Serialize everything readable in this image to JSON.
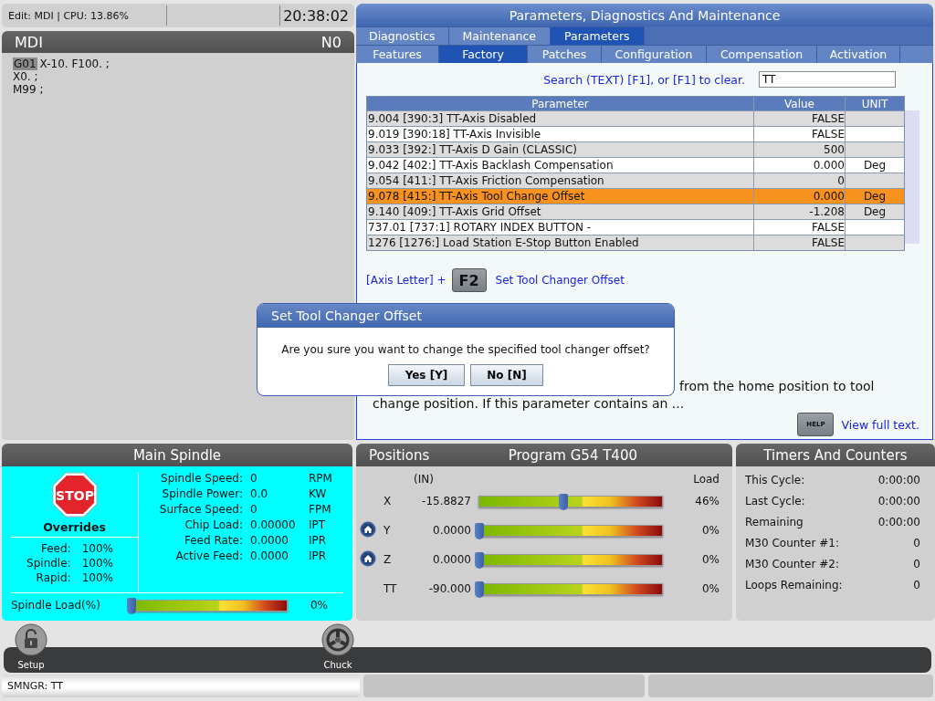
{
  "status_bar": {
    "mode": "Edit: MDI | CPU: 13.86%",
    "clock": "20:38:02"
  },
  "program_panel": {
    "title": "MDI",
    "line_number": "N0",
    "lines": [
      {
        "cursor": "G01",
        "text": "X-10. F100. ;"
      },
      {
        "text": "X0. ;"
      },
      {
        "text": "M99 ;"
      }
    ]
  },
  "parameters_panel": {
    "title": "Parameters, Diagnostics And Maintenance",
    "tabs": [
      {
        "label": "Diagnostics",
        "selected": false
      },
      {
        "label": "Maintenance",
        "selected": false
      },
      {
        "label": "Parameters",
        "selected": true
      }
    ],
    "subtabs": [
      {
        "label": "Features",
        "selected": false
      },
      {
        "label": "Factory",
        "selected": true
      },
      {
        "label": "Patches",
        "selected": false
      },
      {
        "label": "Configuration",
        "selected": false
      },
      {
        "label": "Compensation",
        "selected": false
      },
      {
        "label": "Activation",
        "selected": false
      }
    ],
    "search": {
      "label": "Search (TEXT) [F1], or [F1] to clear.",
      "value": "TT"
    },
    "table": {
      "columns": [
        "Parameter",
        "Value",
        "UNIT"
      ],
      "rows": [
        {
          "parameter": "9.004 [390:3] TT-Axis Disabled",
          "value": "FALSE",
          "selected": false
        },
        {
          "parameter": "9.019 [390:18] TT-Axis Invisible",
          "value": "FALSE",
          "selected": false
        },
        {
          "parameter": "9.033 [392:] TT-Axis D Gain (CLASSIC)",
          "value": "500",
          "selected": false
        },
        {
          "parameter": "9.042 [402:] TT-Axis Backlash Compensation",
          "value": "0.000",
          "unit": "Deg",
          "selected": false
        },
        {
          "parameter": "9.054 [411:] TT-Axis Friction Compensation",
          "value": "0",
          "selected": false
        },
        {
          "parameter": "9.078 [415:] TT-Axis Tool Change Offset",
          "value": "0.000",
          "unit": "Deg",
          "selected": true
        },
        {
          "parameter": "9.140 [409:] TT-Axis Grid Offset",
          "value": "-1.208",
          "unit": "Deg",
          "selected": false
        },
        {
          "parameter": "737.01 [737:1] ROTARY INDEX BUTTON -",
          "value": "FALSE",
          "selected": false
        },
        {
          "parameter": "1276 [1276:] Load Station E-Stop Button Enabled",
          "value": "FALSE",
          "selected": false
        }
      ]
    },
    "hotkeys": [
      {
        "prefix": "[Axis Letter] +",
        "key": "F2",
        "action": "Set Tool Changer Offset"
      }
    ],
    "description": [
      "from the home position to tool",
      "change position. If this parameter contains an ..."
    ],
    "help": {
      "key": "HELP",
      "link": "View full text."
    }
  },
  "dialog": {
    "title": "Set Tool Changer Offset",
    "message": "Are you sure you want to change the specified tool changer offset?",
    "buttons": [
      "Yes [Y]",
      "No [N]"
    ]
  },
  "spindle_panel": {
    "title": "Main Spindle",
    "stop_sign": "STOP",
    "overrides_title": "Overrides",
    "overrides": [
      {
        "label": "Feed:",
        "value": "100%"
      },
      {
        "label": "Spindle:",
        "value": "100%"
      },
      {
        "label": "Rapid:",
        "value": "100%"
      }
    ],
    "readings": [
      {
        "label": "Spindle Speed:",
        "value": "0",
        "unit": "RPM"
      },
      {
        "label": "Spindle Power:",
        "value": "0.0",
        "unit": "KW"
      },
      {
        "label": "Surface Speed:",
        "value": "0",
        "unit": "FPM"
      },
      {
        "label": "Chip Load:",
        "value": "0.00000",
        "unit": "IPT"
      },
      {
        "label": "Feed Rate:",
        "value": "0.0000",
        "unit": "IPR"
      },
      {
        "label": "Active Feed:",
        "value": "0.0000",
        "unit": "IPR"
      }
    ],
    "load": {
      "label": "Spindle Load(%)",
      "level": 0,
      "reading": "0%"
    }
  },
  "positions_panel": {
    "title": "Positions",
    "program": "Program G54 T400",
    "units": "(IN)",
    "load_label": "Load",
    "axes": [
      {
        "name": "X",
        "value": "-15.8827",
        "homed": false,
        "level": 0.46,
        "reading": "46%"
      },
      {
        "name": "Y",
        "value": "0.0000",
        "homed": true,
        "level": 0,
        "reading": "0%"
      },
      {
        "name": "Z",
        "value": "0.0000",
        "homed": true,
        "level": 0,
        "reading": "0%"
      },
      {
        "name": "TT",
        "value": "-90.000",
        "homed": false,
        "level": 0,
        "reading": "0%"
      }
    ]
  },
  "timers_panel": {
    "title": "Timers And Counters",
    "rows": [
      {
        "label": "This Cycle:",
        "value": "0:00:00"
      },
      {
        "label": "Last Cycle:",
        "value": "0:00:00"
      },
      {
        "label": "Remaining",
        "value": "0:00:00"
      },
      {
        "label": "M30 Counter #1:",
        "value": "0"
      },
      {
        "label": "M30 Counter #2:",
        "value": "0"
      },
      {
        "label": "Loops Remaining:",
        "value": "0"
      }
    ]
  },
  "toolbar": {
    "buttons": [
      {
        "label": "Setup",
        "kind": "lock"
      },
      {
        "label": "Chuck",
        "kind": "chuck"
      }
    ]
  },
  "message_bar": {
    "message": "SMNGR: TT"
  }
}
